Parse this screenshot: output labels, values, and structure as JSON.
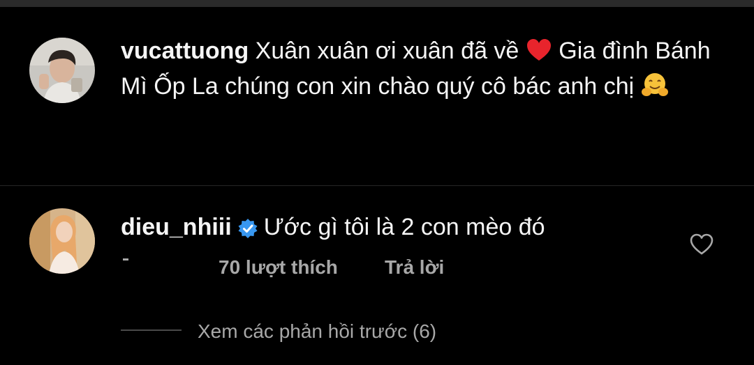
{
  "caption": {
    "username": "vucattuong",
    "text_before_heart": "Xuân xuân ơi xuân đã về ",
    "text_after_heart": " Gia đình Bánh Mì Ốp La chúng con xin chào quý cô bác anh chị "
  },
  "comment": {
    "username": "dieu_nhiii",
    "verified": true,
    "text": "Ước gì tôi là 2 con mèo đó",
    "likes_label": "70 lượt thích",
    "reply_label": "Trả lời",
    "view_replies_label": "Xem các phản hồi trước (6)"
  },
  "icons": {
    "heart_emoji": "red-heart-icon",
    "hug_emoji": "hugging-face-icon",
    "verified_badge": "verified-badge-icon",
    "like_button": "heart-outline-icon"
  },
  "colors": {
    "background": "#000000",
    "primary_text": "#f5f5f5",
    "secondary_text": "#a8a8a8",
    "verified_blue": "#3897f0",
    "heart_red": "#e8242c"
  }
}
